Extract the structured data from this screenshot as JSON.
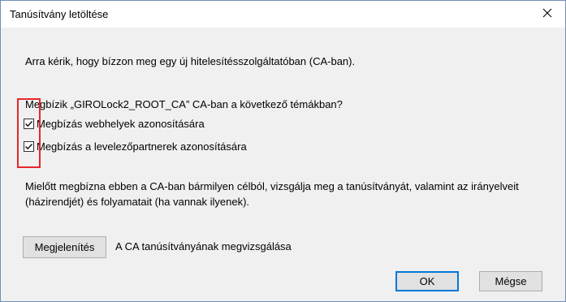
{
  "window": {
    "title": "Tanúsítvány letöltése",
    "close_icon": "close-icon"
  },
  "main": {
    "intro": "Arra kérik, hogy bízzon meg egy új hitelesítésszolgáltatóban (CA-ban).",
    "question": "Megbízik „GIROLock2_ROOT_CA” CA-ban a következő témákban?",
    "options": [
      {
        "label": "Megbízás webhelyek azonosítására",
        "checked": true
      },
      {
        "label": "Megbízás a levelezőpartnerek azonosítására",
        "checked": true
      }
    ],
    "advice": "Mielőtt megbízna ebben a CA-ban bármilyen célból, vizsgálja meg a tanúsítványát, valamint az irányelveit (házirendjét) és folyamatait (ha vannak ilyenek).",
    "view_button": "Megjelenítés",
    "view_description": "A CA tanúsítványának megvizsgálása"
  },
  "footer": {
    "ok_label": "OK",
    "cancel_label": "Mégse"
  },
  "colors": {
    "highlight": "#e8262b",
    "default_button_border": "#0078d7"
  }
}
